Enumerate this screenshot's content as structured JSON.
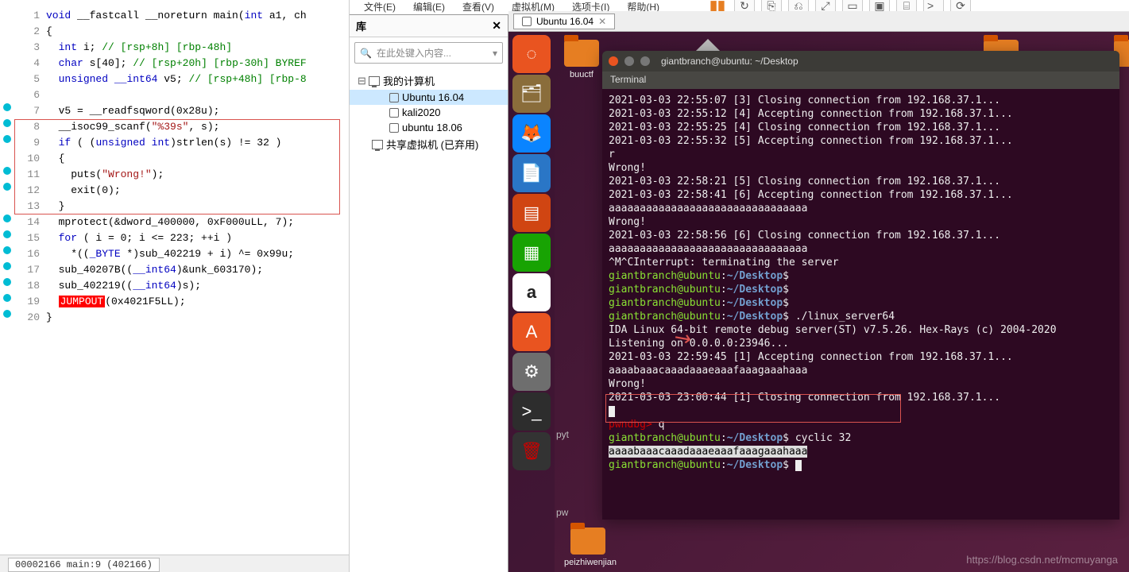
{
  "menu": {
    "file": "文件(E)",
    "edit": "编辑(E)",
    "view": "查看(V)",
    "vm": "虚拟机(M)",
    "tabs": "选项卡(I)",
    "help": "帮助(H)"
  },
  "code": {
    "lines": [
      {
        "n": 1,
        "bp": false,
        "html": "<span class='kw'>void</span> __fastcall __noreturn main(<span class='kw'>int</span> a1, ch"
      },
      {
        "n": 2,
        "bp": false,
        "html": "{"
      },
      {
        "n": 3,
        "bp": false,
        "html": "  <span class='kw'>int</span> i; <span class='cm'>// [rsp+8h] [rbp-48h]</span>"
      },
      {
        "n": 4,
        "bp": false,
        "html": "  <span class='kw'>char</span> s[40]; <span class='cm'>// [rsp+20h] [rbp-30h] BYREF</span>"
      },
      {
        "n": 5,
        "bp": false,
        "html": "  <span class='kw'>unsigned</span> <span class='kw'>__int64</span> v5; <span class='cm'>// [rsp+48h] [rbp-8</span>"
      },
      {
        "n": 6,
        "bp": false,
        "html": ""
      },
      {
        "n": 7,
        "bp": true,
        "html": "  v5 = __readfsqword(0x28u);"
      },
      {
        "n": 8,
        "bp": true,
        "html": "  __isoc99_scanf(<span class='str'>\"%39s\"</span>, s);"
      },
      {
        "n": 9,
        "bp": true,
        "html": "  <span class='kw'>if</span> ( (<span class='ty'>unsigned int</span>)strlen(s) != 32 )"
      },
      {
        "n": 10,
        "bp": false,
        "html": "  {"
      },
      {
        "n": 11,
        "bp": true,
        "html": "    puts(<span class='str'>\"Wrong!\"</span>);"
      },
      {
        "n": 12,
        "bp": true,
        "html": "    exit(0);"
      },
      {
        "n": 13,
        "bp": false,
        "html": "  }"
      },
      {
        "n": 14,
        "bp": true,
        "html": "  mprotect(&amp;dword_400000, 0xF000uLL, 7);"
      },
      {
        "n": 15,
        "bp": true,
        "html": "  <span class='kw'>for</span> ( i = 0; i &lt;= 223; ++i )"
      },
      {
        "n": 16,
        "bp": true,
        "html": "    *((<span class='ty'>_BYTE</span> *)sub_402219 + i) ^= 0x99u;"
      },
      {
        "n": 17,
        "bp": true,
        "html": "  sub_40207B((<span class='ty'>__int64</span>)&amp;unk_603170);"
      },
      {
        "n": 18,
        "bp": true,
        "html": "  sub_402219((<span class='ty'>__int64</span>)s);"
      },
      {
        "n": 19,
        "bp": true,
        "html": "  <span class='jp'>JUMPOUT</span>(0x4021F5LL);"
      },
      {
        "n": 20,
        "bp": true,
        "html": "}"
      }
    ],
    "status": "00002166 main:9 (402166)"
  },
  "lib": {
    "title": "库",
    "search_placeholder": "在此处键入内容...",
    "root": "我的计算机",
    "items": [
      "Ubuntu 16.04",
      "kali2020",
      "ubuntu 18.06"
    ],
    "shared": "共享虚拟机 (已弃用)"
  },
  "vm": {
    "tab": "Ubuntu 16.04",
    "folder1": "buuctf",
    "folder_bottom": "peizhiwenjian",
    "term_title": "giantbranch@ubuntu: ~/Desktop",
    "term_tab": "Terminal",
    "py": "pyt",
    "pw": "pw",
    "watermark": "https://blog.csdn.net/mcmuyanga",
    "prompt_user": "giantbranch@ubuntu",
    "prompt_path": "~/Desktop",
    "lines": [
      "2021-03-03 22:55:07 [3] Closing connection from 192.168.37.1...",
      "2021-03-03 22:55:12 [4] Accepting connection from 192.168.37.1...",
      "2021-03-03 22:55:25 [4] Closing connection from 192.168.37.1...",
      "2021-03-03 22:55:32 [5] Accepting connection from 192.168.37.1...",
      "r",
      "Wrong!",
      "2021-03-03 22:58:21 [5] Closing connection from 192.168.37.1...",
      "2021-03-03 22:58:41 [6] Accepting connection from 192.168.37.1...",
      "aaaaaaaaaaaaaaaaaaaaaaaaaaaaaaaa",
      "Wrong!",
      "2021-03-03 22:58:56 [6] Closing connection from 192.168.37.1...",
      "aaaaaaaaaaaaaaaaaaaaaaaaaaaaaaaa",
      "^M^CInterrupt: terminating the server"
    ],
    "cmd1": "./linux_server64",
    "server_line": "IDA Linux 64-bit remote debug server(ST) v7.5.26. Hex-Rays (c) 2004-2020",
    "listen": "Listening on 0.0.0.0:23946...",
    "accept": "2021-03-03 22:59:45 [1] Accepting connection from 192.168.37.1...",
    "cyclic_out": "aaaabaaacaaadaaaeaaafaaagaaahaaa",
    "wrong": "Wrong!",
    "close2": "2021-03-03 23:00:44 [1] Closing connection from 192.168.37.1...",
    "pwndbg": "pwndbg>",
    "pwndbg_cmd": "q",
    "cmd2": "cyclic 32"
  }
}
